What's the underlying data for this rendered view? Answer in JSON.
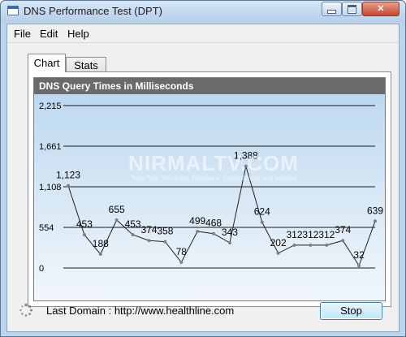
{
  "window": {
    "title": "DNS Performance Test (DPT)"
  },
  "menu": {
    "items": [
      "File",
      "Edit",
      "Help"
    ]
  },
  "tabs": [
    {
      "label": "Chart",
      "active": true
    },
    {
      "label": "Stats",
      "active": false
    }
  ],
  "watermark": {
    "main": "NIRMALTV.COM",
    "sub": "Tech Tips, Windows, Freeware, Social Media and Internet"
  },
  "footer": {
    "domain_text": "Last Domain : http://www.healthline.com",
    "stop_label": "Stop"
  },
  "chart_data": {
    "type": "line",
    "title": "DNS Query Times in Milliseconds",
    "ylim": [
      0,
      2215
    ],
    "yticks": [
      "0",
      "554",
      "1,108",
      "1,661",
      "2,215"
    ],
    "values": [
      1123,
      453,
      188,
      655,
      453,
      374,
      358,
      78,
      499,
      468,
      343,
      1388,
      624,
      202,
      312,
      312,
      312,
      374,
      32,
      639
    ],
    "labels": [
      "1,123",
      "453",
      "188",
      "655",
      "453",
      "374",
      "358",
      "78",
      "499",
      "468",
      "343",
      "1,388",
      "624",
      "202",
      "312",
      "312",
      "312",
      "374",
      "32",
      "639"
    ],
    "line_color": "#1f1f1f",
    "point_color": "#808080"
  }
}
